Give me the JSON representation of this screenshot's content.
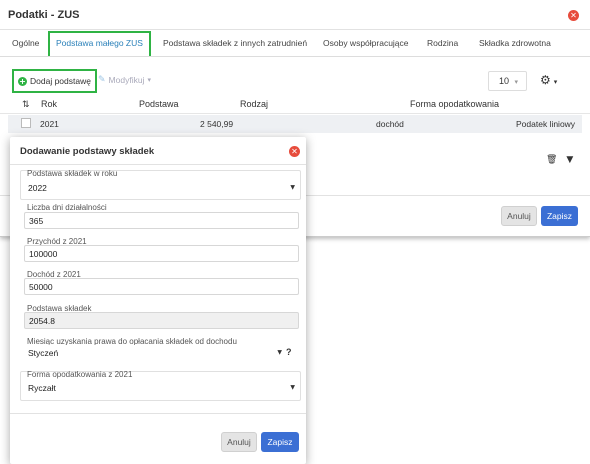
{
  "outer": {
    "title": "Podatki - ZUS",
    "tabs": [
      {
        "label": "Ogólne"
      },
      {
        "label": "Podstawa małego ZUS"
      },
      {
        "label": "Podstawa składek z innych zatrudnień"
      },
      {
        "label": "Osoby współpracujące"
      },
      {
        "label": "Rodzina"
      },
      {
        "label": "Składka zdrowotna"
      }
    ],
    "toolbar": {
      "add_label": "Dodaj podstawę",
      "modify_label": "Modyfikuj",
      "page_size": "10"
    },
    "table": {
      "headers": {
        "sort": "⇅",
        "year": "Rok",
        "base": "Podstawa",
        "type": "Rodzaj",
        "tax_form": "Forma opodatkowania"
      },
      "rows": [
        {
          "year": "2021",
          "base": "2 540,99",
          "type": "dochód",
          "tax_form": "Podatek liniowy"
        }
      ]
    },
    "footer": {
      "cancel": "Anuluj",
      "save": "Zapisz"
    }
  },
  "inner": {
    "title": "Dodawanie podstawy składek",
    "fields": {
      "year_label": "Podstawa składek w roku",
      "year_value": "2022",
      "days_label": "Liczba dni działalności",
      "days_value": "365",
      "income_label": "Przychód z 2021",
      "income_value": "100000",
      "profit_label": "Dochód z 2021",
      "profit_value": "50000",
      "base_label": "Podstawa składek",
      "base_value": "2054.8",
      "month_label": "Miesiąc uzyskania prawa do opłacania składek od dochodu",
      "month_value": "Styczeń",
      "help": "?",
      "taxform_label": "Forma opodatkowania z 2021",
      "taxform_value": "Ryczałt"
    },
    "footer": {
      "cancel": "Anuluj",
      "save": "Zapisz"
    }
  },
  "colors": {
    "accent_green": "#2fb344",
    "primary_blue": "#3b6fd4",
    "close_red": "#e74c3c"
  }
}
